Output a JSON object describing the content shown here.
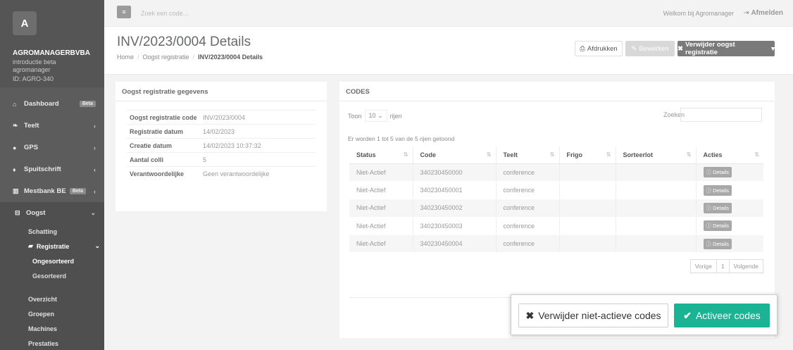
{
  "sidebar": {
    "avatar_letter": "A",
    "company": "AGROMANAGERBVBA",
    "company_sub1": "introductie beta agromanager",
    "company_sub2": "ID: AGRO-340",
    "items": [
      {
        "label": "Dashboard",
        "icon": "home-icon",
        "badge": "Beta"
      },
      {
        "label": "Teelt",
        "icon": "leaf-icon"
      },
      {
        "label": "GPS",
        "icon": "map-marker-icon"
      },
      {
        "label": "Spuitschrift",
        "icon": "drop-icon"
      },
      {
        "label": "Mestbank BE",
        "icon": "bank-icon",
        "badge": "Beta"
      },
      {
        "label": "Oogst",
        "icon": "basket-icon"
      }
    ],
    "sub_items": {
      "schatting": "Schatting",
      "registratie": "Registratie",
      "ongesorteerd": "Ongesorteerd",
      "gesorteerd": "Gesorteerd",
      "overzicht": "Overzicht",
      "groepen": "Groepen",
      "machines": "Machines",
      "prestaties": "Prestaties"
    }
  },
  "topbar": {
    "search_placeholder": "Zoek een code...",
    "welcome": "Welkom bij Agromanager",
    "logout": "Afmelden"
  },
  "heading": {
    "title": "INV/2023/0004 Details",
    "breadcrumb": [
      "Home",
      "Oogst registratie",
      "INV/2023/0004 Details"
    ],
    "print_label": "Afdrukken",
    "edit_label": "Bewerken",
    "delete_label": "Verwijder oogst registratie"
  },
  "details_panel": {
    "title": "Oogst registratie gegevens",
    "rows": [
      {
        "k": "Oogst registratie code",
        "v": "INV/2023/0004"
      },
      {
        "k": "Registratie datum",
        "v": "14/02/2023"
      },
      {
        "k": "Creatie datum",
        "v": "14/02/2023 10:37:32"
      },
      {
        "k": "Aantal colli",
        "v": "5"
      },
      {
        "k": "Verantwoordelijke",
        "v": "Geen verantwoordelijke"
      }
    ]
  },
  "codes_panel": {
    "title": "CODES",
    "toon": "Toon",
    "page_size": "10",
    "rijen": "rijen",
    "zoeken": "Zoeken",
    "info": "Er worden 1 tot 5 van de 5 rijen getoond",
    "columns": [
      "Status",
      "Code",
      "Teelt",
      "Frigo",
      "Sorteerlot",
      "Acties"
    ],
    "rows": [
      {
        "status": "Niet-Actief",
        "code": "340230450000",
        "teelt": "conference",
        "frigo": "",
        "sorteerlot": "",
        "action": "Details"
      },
      {
        "status": "Niet-Actief",
        "code": "340230450001",
        "teelt": "conference",
        "frigo": "",
        "sorteerlot": "",
        "action": "Details"
      },
      {
        "status": "Niet-Actief",
        "code": "340230450002",
        "teelt": "conference",
        "frigo": "",
        "sorteerlot": "",
        "action": "Details"
      },
      {
        "status": "Niet-Actief",
        "code": "340230450003",
        "teelt": "conference",
        "frigo": "",
        "sorteerlot": "",
        "action": "Details"
      },
      {
        "status": "Niet-Actief",
        "code": "340230450004",
        "teelt": "conference",
        "frigo": "",
        "sorteerlot": "",
        "action": "Details"
      }
    ],
    "pager": {
      "prev": "Vorige",
      "page": "1",
      "next": "Volgende"
    }
  },
  "action_box": {
    "delete_inactive": "Verwijder niet-actieve codes",
    "activate": "Activeer codes",
    "accent": "#1ab394"
  }
}
